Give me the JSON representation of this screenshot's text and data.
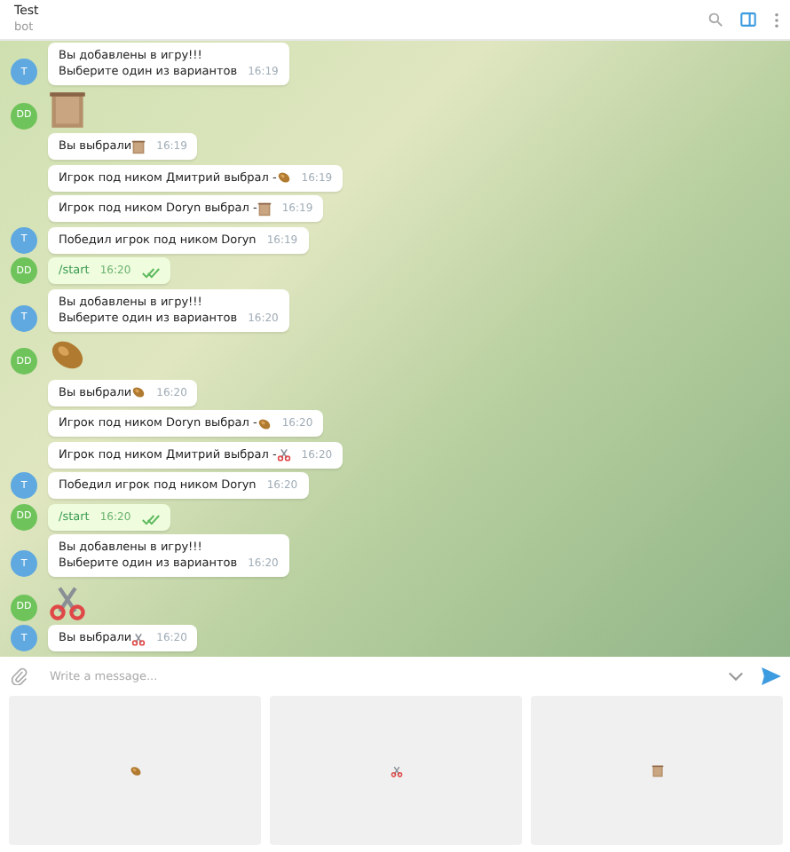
{
  "header": {
    "title": "Test",
    "subtitle": "bot"
  },
  "messages": [
    {
      "kind": "incoming",
      "avatar": "T",
      "lines": [
        "Вы добавлены в игру!!!",
        "Выберите один из вариантов"
      ],
      "time": "16:19"
    },
    {
      "kind": "sticker",
      "avatar": "DD",
      "emoji": {
        "kind": "paper"
      }
    },
    {
      "kind": "incoming",
      "lines": [
        "Вы выбрали"
      ],
      "emoji": {
        "kind": "paper"
      },
      "time": "16:19"
    },
    {
      "kind": "incoming",
      "lines": [
        "Игрок под ником Дмитрий выбрал - "
      ],
      "emoji": {
        "kind": "rock"
      },
      "time": "16:19"
    },
    {
      "kind": "incoming",
      "lines": [
        "Игрок под ником Doryn выбрал - "
      ],
      "emoji": {
        "kind": "paper"
      },
      "time": "16:19"
    },
    {
      "kind": "incoming",
      "avatar": "T",
      "lines": [
        "Победил игрок под ником Doryn"
      ],
      "time": "16:19"
    },
    {
      "kind": "outgoing",
      "avatar": "DD",
      "lines": [
        "/start"
      ],
      "time": "16:20",
      "read": true
    },
    {
      "kind": "incoming",
      "avatar": "T",
      "lines": [
        "Вы добавлены в игру!!!",
        "Выберите один из вариантов"
      ],
      "time": "16:20"
    },
    {
      "kind": "sticker",
      "avatar": "DD",
      "emoji": {
        "kind": "rock"
      }
    },
    {
      "kind": "incoming",
      "lines": [
        "Вы выбрали"
      ],
      "emoji": {
        "kind": "rock"
      },
      "time": "16:20"
    },
    {
      "kind": "incoming",
      "lines": [
        "Игрок под ником Doryn выбрал - "
      ],
      "emoji": {
        "kind": "rock"
      },
      "time": "16:20"
    },
    {
      "kind": "incoming",
      "lines": [
        "Игрок под ником Дмитрий выбрал - "
      ],
      "emoji": {
        "kind": "scissors"
      },
      "time": "16:20"
    },
    {
      "kind": "incoming",
      "avatar": "T",
      "lines": [
        "Победил игрок под ником Doryn"
      ],
      "time": "16:20"
    },
    {
      "kind": "outgoing",
      "avatar": "DD",
      "lines": [
        "/start"
      ],
      "time": "16:20",
      "read": true
    },
    {
      "kind": "incoming",
      "avatar": "T",
      "lines": [
        "Вы добавлены в игру!!!",
        "Выберите один из вариантов"
      ],
      "time": "16:20"
    },
    {
      "kind": "sticker",
      "avatar": "DD",
      "emoji": {
        "kind": "scissors"
      }
    },
    {
      "kind": "incoming",
      "avatar": "T",
      "lines": [
        "Вы выбрали"
      ],
      "emoji": {
        "kind": "scissors"
      },
      "time": "16:20"
    }
  ],
  "composer": {
    "placeholder": "Write a message..."
  },
  "keyboard": [
    {
      "kind": "rock"
    },
    {
      "kind": "scissors"
    },
    {
      "kind": "paper"
    }
  ]
}
